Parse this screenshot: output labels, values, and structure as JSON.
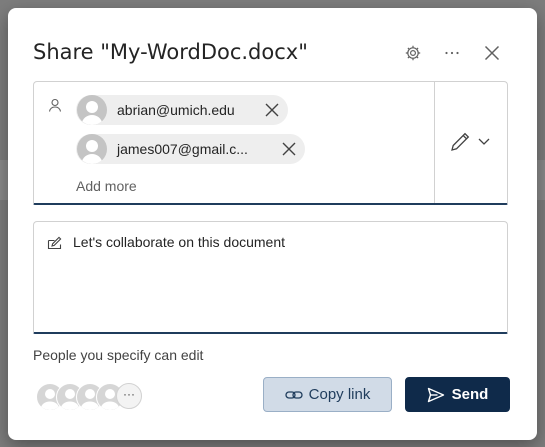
{
  "dialog": {
    "title": "Share \"My-WordDoc.docx\"",
    "header_icons": [
      "gear-icon",
      "more-icon",
      "close-icon"
    ]
  },
  "recipients": [
    {
      "label": "abrian@umich.edu"
    },
    {
      "label": "james007@gmail.c..."
    }
  ],
  "add_more_placeholder": "Add more",
  "permission": {
    "icon": "pencil-icon",
    "dropdown_icon": "chevron-down-icon"
  },
  "message": {
    "text": "Let's collaborate on this document"
  },
  "permission_note": "People you specify can edit",
  "shared_with_overflow": "···",
  "buttons": {
    "copy_link": "Copy link",
    "send": "Send"
  },
  "colors": {
    "primary": "#0f2a4a",
    "secondary_bg": "#d1dbe7",
    "focus_underline": "#1f3c5c"
  }
}
